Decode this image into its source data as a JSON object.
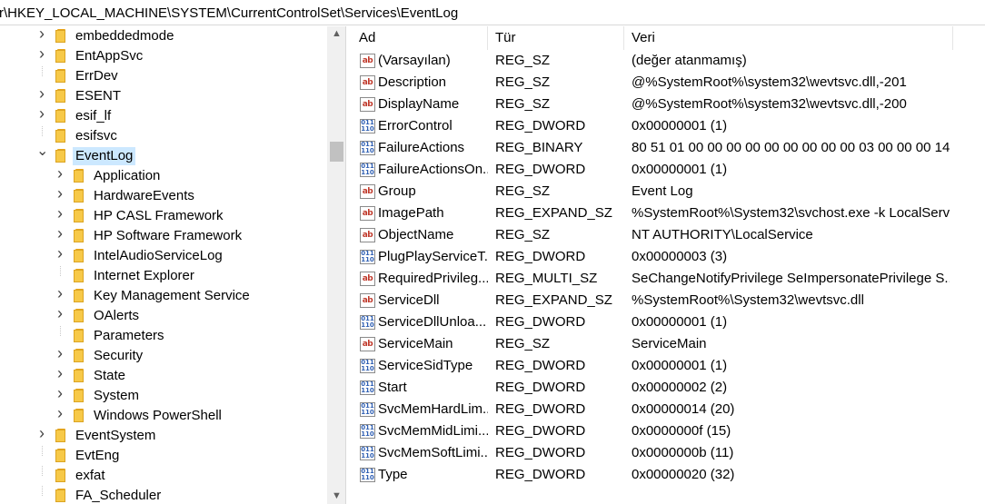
{
  "address": "r\\HKEY_LOCAL_MACHINE\\SYSTEM\\CurrentControlSet\\Services\\EventLog",
  "columns": {
    "name": "Ad",
    "type": "Tür",
    "data": "Veri"
  },
  "tree": [
    {
      "label": "embeddedmode",
      "expand": "collapsed",
      "level": 0
    },
    {
      "label": "EntAppSvc",
      "expand": "collapsed",
      "level": 0
    },
    {
      "label": "ErrDev",
      "expand": "none",
      "level": 0
    },
    {
      "label": "ESENT",
      "expand": "collapsed",
      "level": 0
    },
    {
      "label": "esif_lf",
      "expand": "collapsed",
      "level": 0
    },
    {
      "label": "esifsvc",
      "expand": "none",
      "level": 0
    },
    {
      "label": "EventLog",
      "expand": "expanded",
      "level": 0,
      "selected": true
    },
    {
      "label": "Application",
      "expand": "collapsed",
      "level": 1
    },
    {
      "label": "HardwareEvents",
      "expand": "collapsed",
      "level": 1
    },
    {
      "label": "HP CASL Framework",
      "expand": "collapsed",
      "level": 1
    },
    {
      "label": "HP Software Framework",
      "expand": "collapsed",
      "level": 1
    },
    {
      "label": "IntelAudioServiceLog",
      "expand": "collapsed",
      "level": 1
    },
    {
      "label": "Internet Explorer",
      "expand": "none",
      "level": 1
    },
    {
      "label": "Key Management Service",
      "expand": "collapsed",
      "level": 1
    },
    {
      "label": "OAlerts",
      "expand": "collapsed",
      "level": 1
    },
    {
      "label": "Parameters",
      "expand": "none",
      "level": 1
    },
    {
      "label": "Security",
      "expand": "collapsed",
      "level": 1
    },
    {
      "label": "State",
      "expand": "collapsed",
      "level": 1
    },
    {
      "label": "System",
      "expand": "collapsed",
      "level": 1
    },
    {
      "label": "Windows PowerShell",
      "expand": "collapsed",
      "level": 1
    },
    {
      "label": "EventSystem",
      "expand": "collapsed",
      "level": 0
    },
    {
      "label": "EvtEng",
      "expand": "none",
      "level": 0
    },
    {
      "label": "exfat",
      "expand": "none",
      "level": 0
    },
    {
      "label": "FA_Scheduler",
      "expand": "none",
      "level": 0
    }
  ],
  "values": [
    {
      "icon": "string",
      "name": "(Varsayılan)",
      "type": "REG_SZ",
      "data": "(değer atanmamış)"
    },
    {
      "icon": "string",
      "name": "Description",
      "type": "REG_SZ",
      "data": "@%SystemRoot%\\system32\\wevtsvc.dll,-201"
    },
    {
      "icon": "string",
      "name": "DisplayName",
      "type": "REG_SZ",
      "data": "@%SystemRoot%\\system32\\wevtsvc.dll,-200"
    },
    {
      "icon": "binary",
      "name": "ErrorControl",
      "type": "REG_DWORD",
      "data": "0x00000001 (1)"
    },
    {
      "icon": "binary",
      "name": "FailureActions",
      "type": "REG_BINARY",
      "data": "80 51 01 00 00 00 00 00 00 00 00 00 03 00 00 00 14..."
    },
    {
      "icon": "binary",
      "name": "FailureActionsOn...",
      "type": "REG_DWORD",
      "data": "0x00000001 (1)"
    },
    {
      "icon": "string",
      "name": "Group",
      "type": "REG_SZ",
      "data": "Event Log"
    },
    {
      "icon": "string",
      "name": "ImagePath",
      "type": "REG_EXPAND_SZ",
      "data": "%SystemRoot%\\System32\\svchost.exe -k LocalServ..."
    },
    {
      "icon": "string",
      "name": "ObjectName",
      "type": "REG_SZ",
      "data": "NT AUTHORITY\\LocalService"
    },
    {
      "icon": "binary",
      "name": "PlugPlayServiceT...",
      "type": "REG_DWORD",
      "data": "0x00000003 (3)"
    },
    {
      "icon": "string",
      "name": "RequiredPrivileg...",
      "type": "REG_MULTI_SZ",
      "data": "SeChangeNotifyPrivilege SeImpersonatePrivilege S..."
    },
    {
      "icon": "string",
      "name": "ServiceDll",
      "type": "REG_EXPAND_SZ",
      "data": "%SystemRoot%\\System32\\wevtsvc.dll"
    },
    {
      "icon": "binary",
      "name": "ServiceDllUnloa...",
      "type": "REG_DWORD",
      "data": "0x00000001 (1)"
    },
    {
      "icon": "string",
      "name": "ServiceMain",
      "type": "REG_SZ",
      "data": "ServiceMain"
    },
    {
      "icon": "binary",
      "name": "ServiceSidType",
      "type": "REG_DWORD",
      "data": "0x00000001 (1)"
    },
    {
      "icon": "binary",
      "name": "Start",
      "type": "REG_DWORD",
      "data": "0x00000002 (2)"
    },
    {
      "icon": "binary",
      "name": "SvcMemHardLim...",
      "type": "REG_DWORD",
      "data": "0x00000014 (20)"
    },
    {
      "icon": "binary",
      "name": "SvcMemMidLimi...",
      "type": "REG_DWORD",
      "data": "0x0000000f (15)"
    },
    {
      "icon": "binary",
      "name": "SvcMemSoftLimi...",
      "type": "REG_DWORD",
      "data": "0x0000000b (11)"
    },
    {
      "icon": "binary",
      "name": "Type",
      "type": "REG_DWORD",
      "data": "0x00000020 (32)"
    }
  ]
}
